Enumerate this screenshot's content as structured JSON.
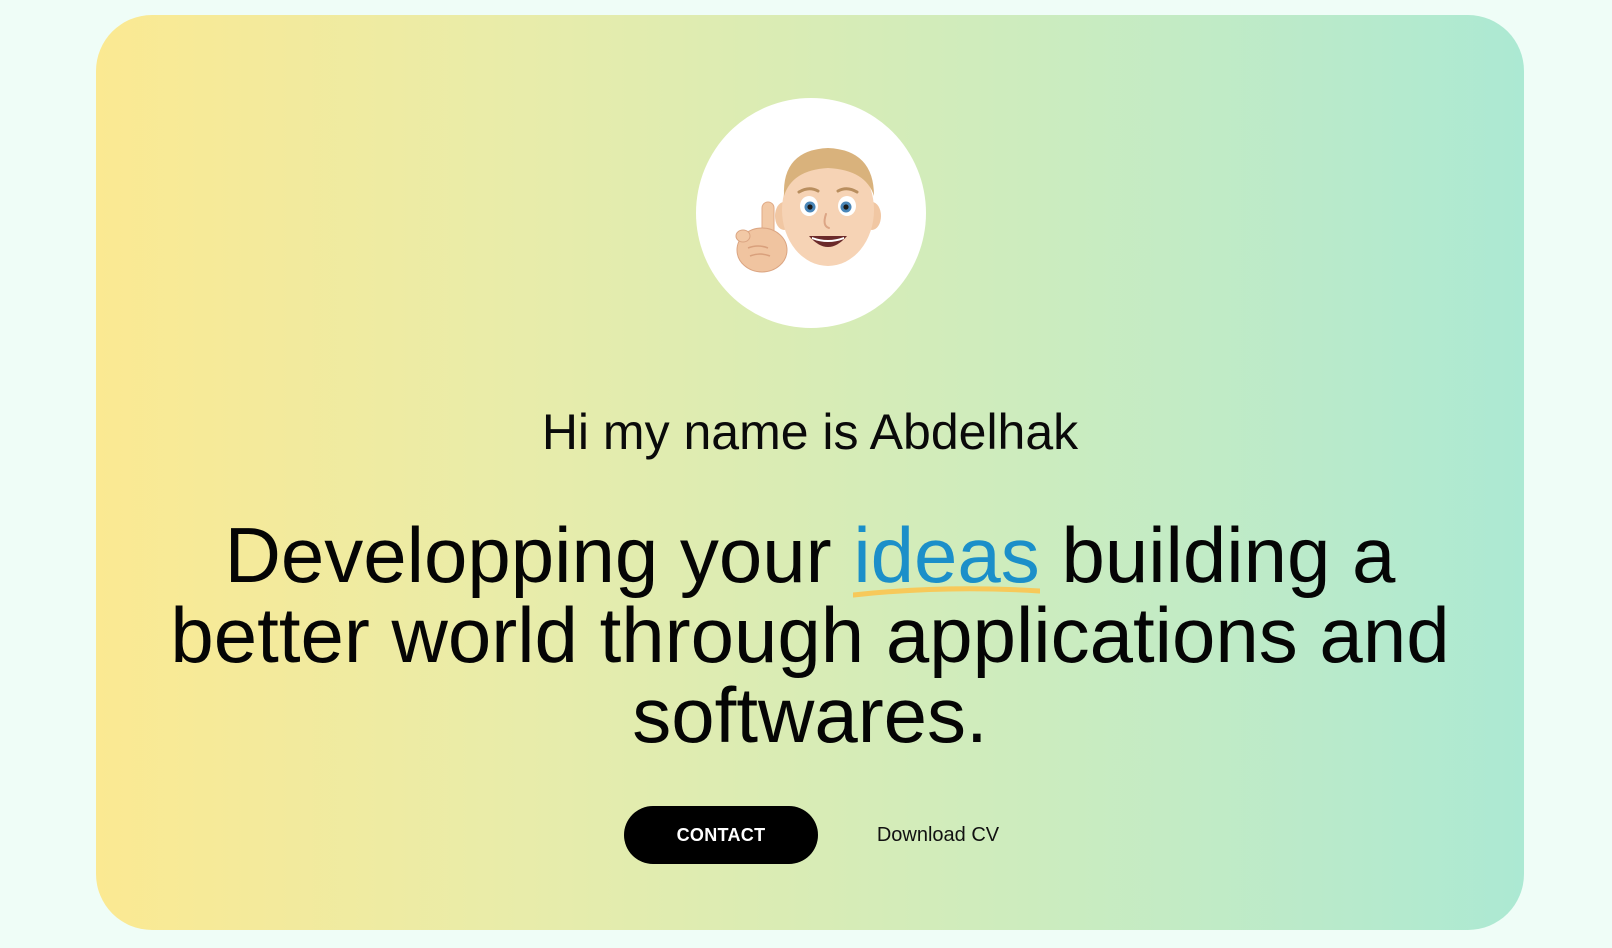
{
  "hero": {
    "avatar_icon": "memoji-pointing-up-icon",
    "greeting": "Hi my name is Abdelhak",
    "headline_before": "Developping your ",
    "headline_highlight": "ideas",
    "headline_after": " building a better world through applications and softwares.",
    "contact_label": "CONTACT",
    "download_label": "Download CV"
  },
  "colors": {
    "background": "#effdf7",
    "gradient_start": "#fbe992",
    "gradient_end": "#ace9d3",
    "highlight_text": "#1b8fc9",
    "highlight_underline": "#f7c95a",
    "button_bg": "#000000",
    "button_text": "#ffffff"
  }
}
